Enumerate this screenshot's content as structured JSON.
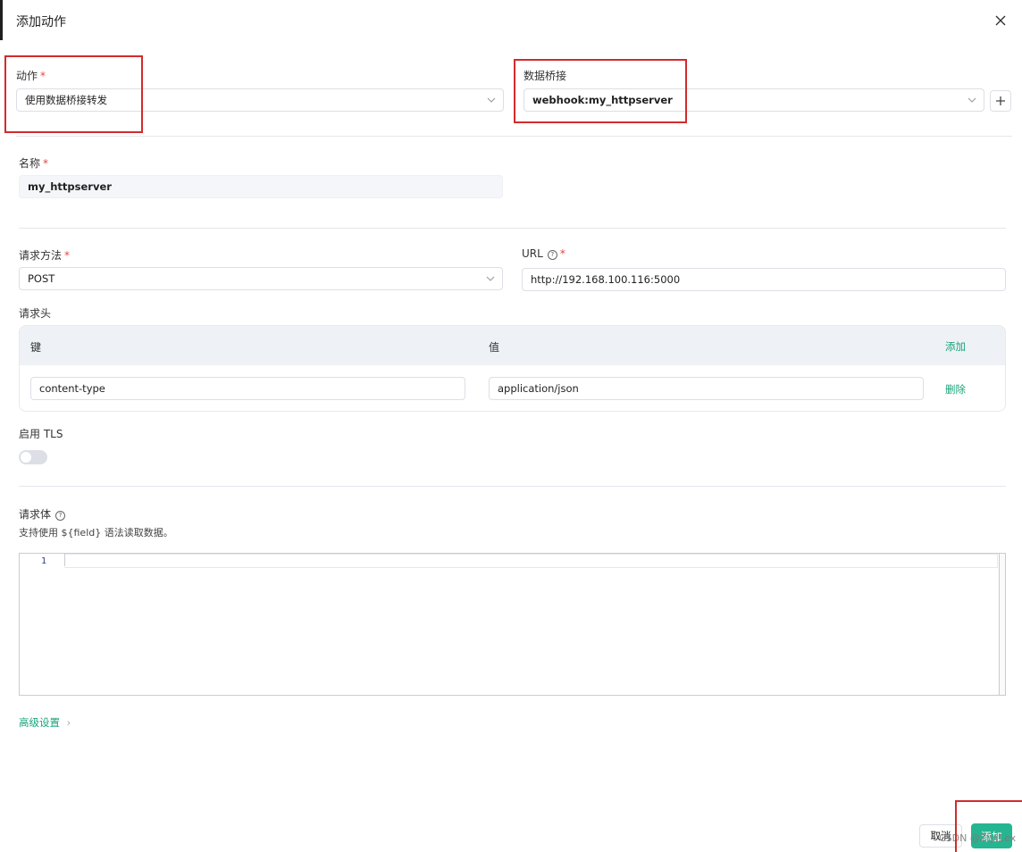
{
  "dialog": {
    "title": "添加动作",
    "close_icon": "close-icon"
  },
  "action": {
    "label": "动作",
    "required_mark": "*",
    "value": "使用数据桥接转发"
  },
  "bridge": {
    "label": "数据桥接",
    "value": "webhook:my_httpserver",
    "add_icon": "plus-icon"
  },
  "name": {
    "label": "名称",
    "required_mark": "*",
    "value": "my_httpserver"
  },
  "method": {
    "label": "请求方法",
    "required_mark": "*",
    "value": "POST"
  },
  "url": {
    "label": "URL",
    "help_icon": "?",
    "required_mark": "*",
    "value": "http://192.168.100.116:5000"
  },
  "headers": {
    "label": "请求头",
    "col_key": "键",
    "col_value": "值",
    "add_label": "添加",
    "rows": [
      {
        "key": "content-type",
        "value": "application/json",
        "delete_label": "删除"
      }
    ]
  },
  "tls": {
    "label": "启用 TLS",
    "enabled": false
  },
  "body": {
    "label": "请求体",
    "help_icon": "?",
    "hint": "支持使用 ${field} 语法读取数据。",
    "line_number": "1"
  },
  "advanced": {
    "label": "高级设置",
    "chevron": "›"
  },
  "footer": {
    "cancel_label": "取消",
    "submit_label": "添加",
    "watermark": "CSDN @Ziyi1ex"
  },
  "colors": {
    "accent": "#26b591",
    "link": "#1aa37a",
    "required": "#e54545",
    "annotation_box": "#d22b2b"
  }
}
